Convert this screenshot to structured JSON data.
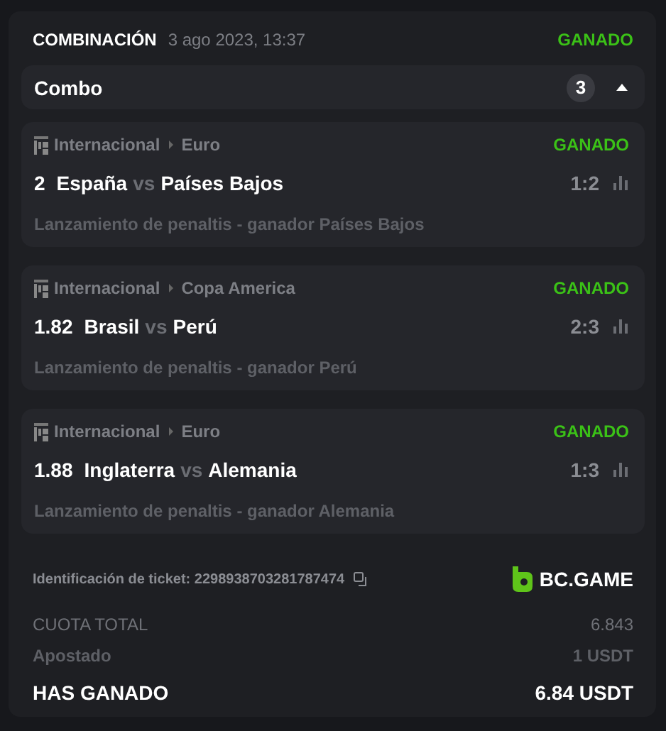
{
  "header": {
    "type": "COMBINACIÓN",
    "datetime": "3 ago 2023, 13:37",
    "status": "GANADO"
  },
  "combo": {
    "label": "Combo",
    "count": "3",
    "expanded": true
  },
  "legs": [
    {
      "category": "Internacional",
      "league": "Euro",
      "status": "GANADO",
      "odds": "2",
      "home": "España",
      "vs": "vs",
      "away": "Países Bajos",
      "score": "1:2",
      "market": "Lanzamiento de penaltis - ganador Países Bajos"
    },
    {
      "category": "Internacional",
      "league": "Copa America",
      "status": "GANADO",
      "odds": "1.82",
      "home": "Brasil",
      "vs": "vs",
      "away": "Perú",
      "score": "2:3",
      "market": "Lanzamiento de penaltis - ganador Perú"
    },
    {
      "category": "Internacional",
      "league": "Euro",
      "status": "GANADO",
      "odds": "1.88",
      "home": "Inglaterra",
      "vs": "vs",
      "away": "Alemania",
      "score": "1:3",
      "market": "Lanzamiento de penaltis - ganador Alemania"
    }
  ],
  "ticket": {
    "label": "Identificación de ticket: 2298938703281787474",
    "brand": "BC.GAME"
  },
  "totals": [
    {
      "kind": "plain",
      "label": "CUOTA TOTAL",
      "value": "6.843"
    },
    {
      "kind": "muted",
      "label": "Apostado",
      "value": "1 USDT"
    },
    {
      "kind": "strong",
      "label": "HAS GANADO",
      "value": "6.84 USDT"
    }
  ]
}
